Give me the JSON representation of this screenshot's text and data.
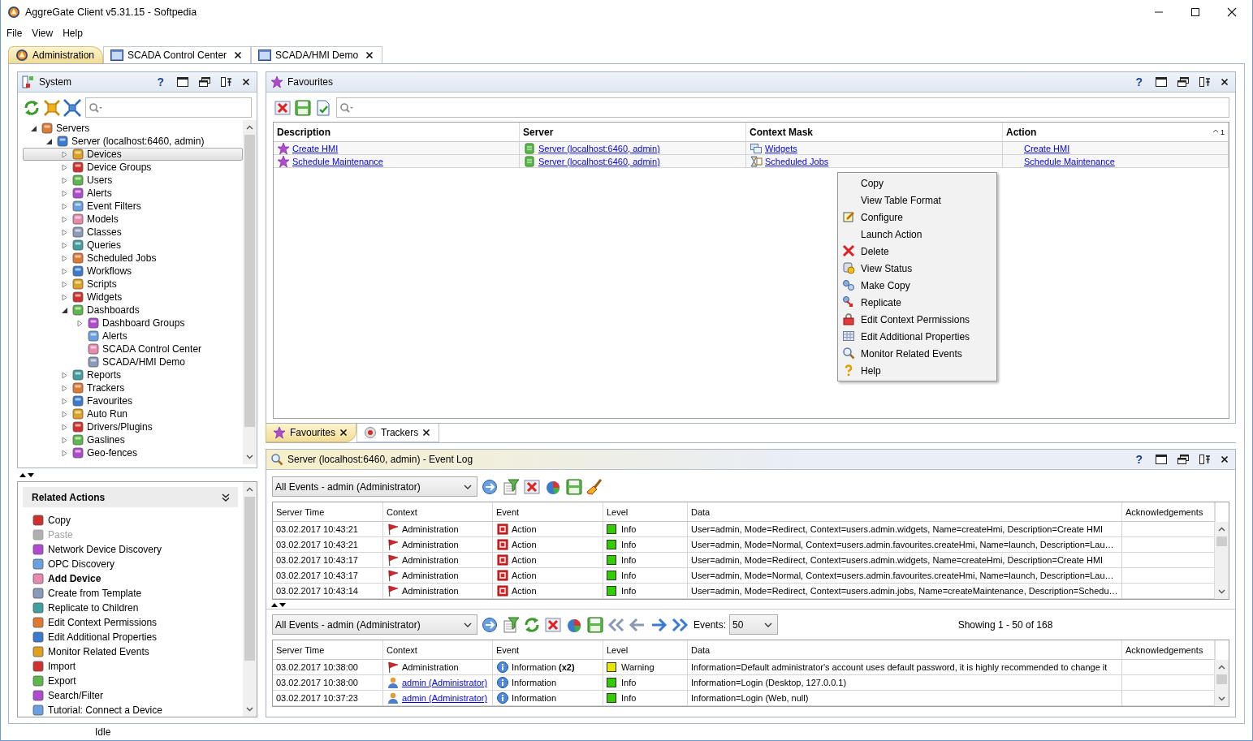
{
  "window": {
    "title": "AggreGate Client v5.31.15 - Softpedia"
  },
  "menu": [
    "File",
    "View",
    "Help"
  ],
  "tabs": [
    {
      "label": "Administration",
      "selected": true,
      "closable": false
    },
    {
      "label": "SCADA Control Center",
      "selected": false,
      "closable": true
    },
    {
      "label": "SCADA/HMI Demo",
      "selected": false,
      "closable": true
    }
  ],
  "system_panel": {
    "title": "System",
    "help": "?"
  },
  "tree": [
    {
      "label": "Servers",
      "expanded": true,
      "selected": false,
      "children": [
        {
          "label": "Server (localhost:6460, admin)",
          "expanded": true,
          "selected": false,
          "children": [
            {
              "label": "Devices",
              "expanded": false,
              "selected": true
            },
            {
              "label": "Device Groups",
              "expanded": false,
              "selected": false
            },
            {
              "label": "Users",
              "expanded": false,
              "selected": false
            },
            {
              "label": "Alerts",
              "expanded": false,
              "selected": false
            },
            {
              "label": "Event Filters",
              "expanded": false,
              "selected": false
            },
            {
              "label": "Models",
              "expanded": false,
              "selected": false
            },
            {
              "label": "Classes",
              "expanded": false,
              "selected": false
            },
            {
              "label": "Queries",
              "expanded": false,
              "selected": false
            },
            {
              "label": "Scheduled Jobs",
              "expanded": false,
              "selected": false
            },
            {
              "label": "Workflows",
              "expanded": false,
              "selected": false
            },
            {
              "label": "Scripts",
              "expanded": false,
              "selected": false
            },
            {
              "label": "Widgets",
              "expanded": false,
              "selected": false
            },
            {
              "label": "Dashboards",
              "expanded": true,
              "selected": false,
              "children": [
                {
                  "label": "Dashboard Groups",
                  "expanded": false,
                  "selected": false
                },
                {
                  "label": "Alerts",
                  "selected": false
                },
                {
                  "label": "SCADA Control Center",
                  "selected": false
                },
                {
                  "label": "SCADA/HMI Demo",
                  "selected": false
                }
              ]
            },
            {
              "label": "Reports",
              "expanded": false,
              "selected": false
            },
            {
              "label": "Trackers",
              "expanded": false,
              "selected": false
            },
            {
              "label": "Favourites",
              "expanded": false,
              "selected": false
            },
            {
              "label": "Auto Run",
              "expanded": false,
              "selected": false
            },
            {
              "label": "Drivers/Plugins",
              "expanded": false,
              "selected": false
            },
            {
              "label": "Gaslines",
              "expanded": false,
              "selected": false
            },
            {
              "label": "Geo-fences",
              "expanded": false,
              "selected": false
            }
          ]
        }
      ]
    }
  ],
  "related_actions": {
    "title": "Related Actions",
    "items": [
      {
        "label": "Copy",
        "disabled": false,
        "primary": false
      },
      {
        "label": "Paste",
        "disabled": true,
        "primary": false
      },
      {
        "label": "Network Device Discovery",
        "disabled": false,
        "primary": false
      },
      {
        "label": "OPC Discovery",
        "disabled": false,
        "primary": false
      },
      {
        "label": "Add Device",
        "disabled": false,
        "primary": true
      },
      {
        "label": "Create from Template",
        "disabled": false,
        "primary": false
      },
      {
        "label": "Replicate to Children",
        "disabled": false,
        "primary": false
      },
      {
        "label": "Edit Context Permissions",
        "disabled": false,
        "primary": false
      },
      {
        "label": "Edit Additional Properties",
        "disabled": false,
        "primary": false
      },
      {
        "label": "Monitor Related Events",
        "disabled": false,
        "primary": false
      },
      {
        "label": "Import",
        "disabled": false,
        "primary": false
      },
      {
        "label": "Export",
        "disabled": false,
        "primary": false
      },
      {
        "label": "Search/Filter",
        "disabled": false,
        "primary": false
      },
      {
        "label": "Tutorial: Connect a Device",
        "disabled": false,
        "primary": false
      }
    ]
  },
  "favourites": {
    "title": "Favourites",
    "help": "?",
    "columns": [
      {
        "label": "Description"
      },
      {
        "label": "Server"
      },
      {
        "label": "Context Mask"
      },
      {
        "label": "Action",
        "sort_rank": "1"
      }
    ],
    "rows": [
      {
        "description": "Create HMI",
        "server": "Server (localhost:6460, admin)",
        "context_mask": "Widgets",
        "action": "Create HMI"
      },
      {
        "description": "Schedule Maintenance",
        "server": "Server (localhost:6460, admin)",
        "context_mask": "Scheduled Jobs",
        "action": "Schedule Maintenance"
      }
    ]
  },
  "context_menu": [
    "Copy",
    "View Table Format",
    "Configure",
    "Launch Action",
    "Delete",
    "View Status",
    "Make Copy",
    "Replicate",
    "Edit Context Permissions",
    "Edit Additional Properties",
    "Monitor Related Events",
    "Help"
  ],
  "bottom_tabs": [
    {
      "label": "Favourites",
      "selected": true
    },
    {
      "label": "Trackers",
      "selected": false
    }
  ],
  "event_log": {
    "title": "Server (localhost:6460, admin) - Event Log",
    "help": "?",
    "upper": {
      "filter": "All Events - admin (Administrator)",
      "columns": [
        "Server Time",
        "Context",
        "Event",
        "Level",
        "Data",
        "Acknowledgements"
      ],
      "rows": [
        {
          "server_time": "03.02.2017 10:43:21",
          "context": {
            "text": "Administration",
            "kind": "system"
          },
          "event": {
            "text": "Action",
            "kind": "action"
          },
          "level": "Info",
          "color": "#33cc00",
          "data": "User=admin, Mode=Redirect, Context=users.admin.widgets, Name=createHmi, Description=Create HMI"
        },
        {
          "server_time": "03.02.2017 10:43:21",
          "context": {
            "text": "Administration",
            "kind": "system"
          },
          "event": {
            "text": "Action",
            "kind": "action"
          },
          "level": "Info",
          "color": "#33cc00",
          "data": "User=admin, Mode=Normal, Context=users.admin.favourites.createHmi, Name=launch, Description=Lau…"
        },
        {
          "server_time": "03.02.2017 10:43:17",
          "context": {
            "text": "Administration",
            "kind": "system"
          },
          "event": {
            "text": "Action",
            "kind": "action"
          },
          "level": "Info",
          "color": "#33cc00",
          "data": "User=admin, Mode=Redirect, Context=users.admin.widgets, Name=createHmi, Description=Create HMI"
        },
        {
          "server_time": "03.02.2017 10:43:17",
          "context": {
            "text": "Administration",
            "kind": "system"
          },
          "event": {
            "text": "Action",
            "kind": "action"
          },
          "level": "Info",
          "color": "#33cc00",
          "data": "User=admin, Mode=Normal, Context=users.admin.favourites.createHmi, Name=launch, Description=Lau…"
        },
        {
          "server_time": "03.02.2017 10:43:14",
          "context": {
            "text": "Administration",
            "kind": "system"
          },
          "event": {
            "text": "Action",
            "kind": "action"
          },
          "level": "Info",
          "color": "#33cc00",
          "data": "User=admin, Mode=Redirect, Context=users.admin.jobs, Name=createMaintenance, Description=Schedu…"
        }
      ]
    },
    "lower": {
      "filter": "All Events - admin (Administrator)",
      "events_label": "Events:",
      "page_size": "50",
      "showing": "Showing 1 - 50 of 168",
      "columns": [
        "Server Time",
        "Context",
        "Event",
        "Level",
        "Data",
        "Acknowledgements"
      ],
      "rows": [
        {
          "server_time": "03.02.2017 10:38:00",
          "context": {
            "text": "Administration",
            "kind": "system"
          },
          "event": {
            "text": "Information **(x2)**",
            "kind": "information"
          },
          "level": "Warning",
          "color": "#e6e600",
          "data": "Information=Default administrator's account uses default password, it is highly recommended to change it"
        },
        {
          "server_time": "03.02.2017 10:38:00",
          "context": {
            "text": "admin (Administrator)",
            "kind": "user"
          },
          "event": {
            "text": "Information",
            "kind": "information"
          },
          "level": "Info",
          "color": "#33cc00",
          "data": "Information=Login (Desktop, 127.0.0.1)"
        },
        {
          "server_time": "03.02.2017 10:37:23",
          "context": {
            "text": "admin (Administrator)",
            "kind": "user"
          },
          "event": {
            "text": "Information",
            "kind": "information"
          },
          "level": "Info",
          "color": "#33cc00",
          "data": "Information=Login (Web, null)"
        }
      ]
    }
  },
  "status_bar": {
    "text": "Idle"
  }
}
